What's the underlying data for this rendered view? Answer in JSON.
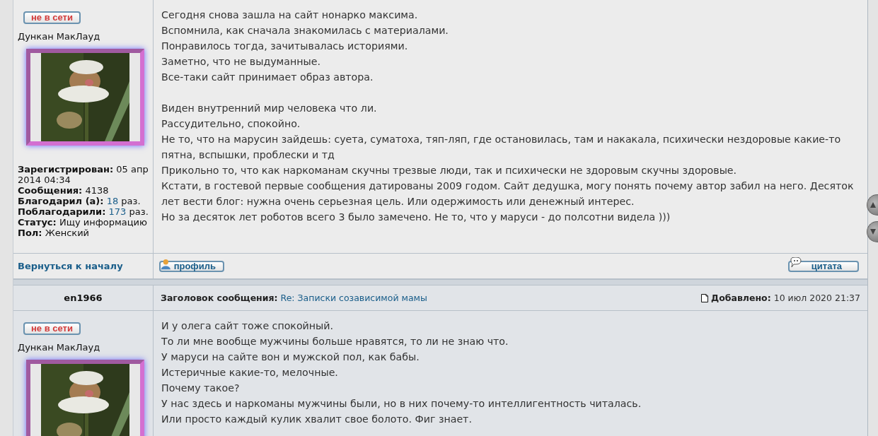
{
  "posts": [
    {
      "author": {
        "status_badge": "не в сети",
        "rank": "Дункан МакЛауд",
        "fields": [
          {
            "label": "Зарегистрирован:",
            "value": "05 апр 2014 04:34",
            "kind": "plain"
          },
          {
            "label": "Сообщения:",
            "value": "4138",
            "kind": "plain"
          },
          {
            "label": "Благодарил (а):",
            "value": "18",
            "suffix": "раз.",
            "kind": "link"
          },
          {
            "label": "Поблагодарили:",
            "value": "173",
            "suffix": "раз.",
            "kind": "link"
          },
          {
            "label": "Статус:",
            "value": "Ищу информацию",
            "kind": "plain"
          },
          {
            "label": "Пол:",
            "value": "Женский",
            "kind": "plain"
          }
        ]
      },
      "paragraphs": [
        [
          "Сегодня снова зашла на сайт нонарко максима.",
          "Вспомнила, как сначала знакомилась с материалами.",
          "Понравилось тогда, зачитывалась историями.",
          "Заметно, что не выдуманные.",
          "Все-таки сайт принимает образ автора."
        ],
        [
          "Виден внутренний мир человека что ли.",
          "Рассудительно, спокойно.",
          "Не то, что на марусин зайдешь: суета, суматоха, тяп-ляп, где остановилась, там и накакала, психически нездоровые какие-то пятна, вспышки, проблески и тд",
          "Прикольно то, что как наркоманам скучны трезвые люди, так и психически не здоровым скучны здоровые.",
          "Кстати, в гостевой первые сообщения датированы 2009 годом. Сайт дедушка, могу понять почему автор забил на него. Десяток лет вести блог: нужна очень серьезная цель. Или одержимость или денежный интерес.",
          "Но за десяток лет роботов всего 3 было замечено. Не то, что у маруси - до полсотни видела )))"
        ]
      ],
      "footer": {
        "back_link": "Вернуться к началу",
        "profile_button": "профиль",
        "quote_button": "цитата"
      }
    },
    {
      "header": {
        "author_name": "en1966",
        "subject_label": "Заголовок сообщения:",
        "subject": "Re: Записки созависимой мамы",
        "added_label": "Добавлено:",
        "added": "10 июл 2020 21:37"
      },
      "author": {
        "status_badge": "не в сети",
        "rank": "Дункан МакЛауд"
      },
      "paragraphs": [
        [
          "И у олега сайт тоже спокойный.",
          "То ли мне вообще мужчины больше нравятся, то ли не знаю что.",
          "У маруси на сайте вон и мужской пол, как бабы.",
          "Истеричные какие-то, мелочные.",
          "Почему такое?",
          "У нас здесь и наркоманы мужчины были, но в них почему-то интеллигентность читалась.",
          "Или просто каждый кулик хвалит свое болото. Фиг знает."
        ]
      ]
    }
  ]
}
